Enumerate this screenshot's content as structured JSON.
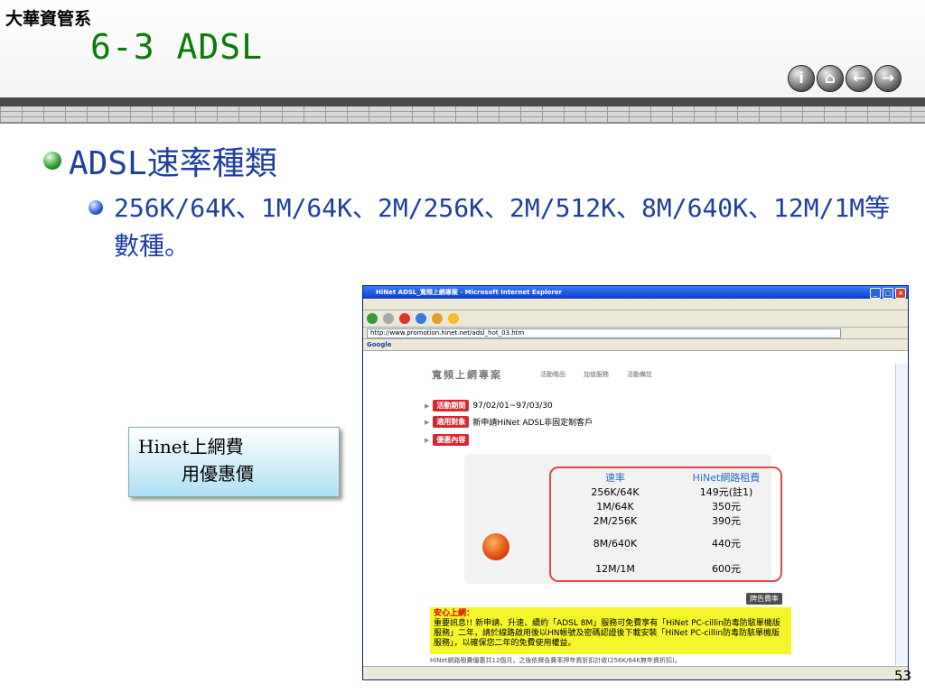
{
  "header": {
    "department": "大華資管系",
    "title": "6-3 ADSL",
    "nav_buttons": [
      {
        "glyph": "i",
        "icon": "info-icon"
      },
      {
        "glyph": "⌂",
        "icon": "home-icon"
      },
      {
        "glyph": "←",
        "icon": "arrow-left-icon"
      },
      {
        "glyph": "→",
        "icon": "arrow-right-icon"
      }
    ]
  },
  "content": {
    "bullet1": "ADSL速率種類",
    "bullet2": "256K/64K、1M/64K、2M/256K、2M/512K、8M/640K、12M/1M等數種。"
  },
  "callout": {
    "line1": "Hinet上網費",
    "line2": "用優惠價"
  },
  "page_number": "53",
  "screenshot": {
    "window_title": "HiNet ADSL_寬頻上網專案 - Microsoft Internet Explorer",
    "address": "http://www.promotion.hinet.net/adsl_hot_03.htm",
    "site_heading": "寬頻上網專案",
    "site_nav": [
      "活動贈品",
      "加值服務",
      "活動備註"
    ],
    "rows": [
      {
        "tag": "活動期間",
        "text": "97/02/01~97/03/30"
      },
      {
        "tag": "適用對象",
        "text": "新申請HiNet ADSL非固定制客戶"
      },
      {
        "tag": "優惠內容",
        "text": ""
      }
    ],
    "table": {
      "headers": [
        "速率",
        "HiNet網路租費"
      ],
      "rows": [
        [
          "256K/64K",
          "149元(註1)"
        ],
        [
          "1M/64K",
          "350元"
        ],
        [
          "2M/256K",
          "390元"
        ],
        [
          "8M/640K",
          "440元"
        ],
        [
          "12M/1M",
          "600元"
        ]
      ]
    },
    "rate_button": "牌告費率",
    "notice_title": "安心上網：",
    "notice_text": "重要訊息!! 新申請、升速、續約「ADSL 8M」服務可免費享有「HiNet PC-cillin防毒防駭單機版服務」二年，請於線路啟用後以HN帳號及密碼認證後下載安裝「HiNet PC-cillin防毒防駭單機版服務」，以確保您二年的免費使用權益。",
    "footer_note": "HiNet網路租費優惠共12個月，之後依牌告費率押年資折扣計收(256K/64K無年資折扣)。"
  }
}
